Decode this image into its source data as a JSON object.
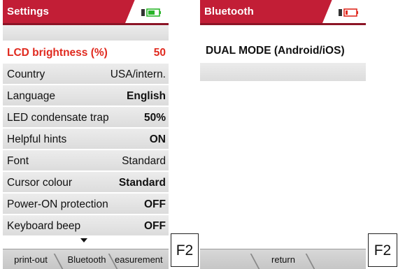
{
  "settings": {
    "title": "Settings",
    "rows": [
      {
        "label": "LCD brightness (%)",
        "value": "50"
      },
      {
        "label": "Country",
        "value": "USA/intern."
      },
      {
        "label": "Language",
        "value": "English"
      },
      {
        "label": "LED condensate trap",
        "value": "50%"
      },
      {
        "label": "Helpful hints",
        "value": "ON"
      },
      {
        "label": "Font",
        "value": "Standard"
      },
      {
        "label": "Cursor colour",
        "value": "Standard"
      },
      {
        "label": "Power-ON protection",
        "value": "OFF"
      },
      {
        "label": "Keyboard beep",
        "value": "OFF"
      }
    ],
    "softkeys": [
      "print-out",
      "Bluetooth",
      "easurement"
    ],
    "f2_label": "F2"
  },
  "bluetooth": {
    "title": "Bluetooth",
    "rows": [
      {
        "label": "DUAL MODE (Android/iOS)"
      },
      {
        "label": ""
      }
    ],
    "softkeys": [
      "",
      "return",
      ""
    ],
    "f2_label": "F2"
  },
  "colors": {
    "titlebar": "#c21e36",
    "selected_text": "#e02a1f",
    "battery_green": "#2bb52b",
    "battery_red": "#e02a1f"
  },
  "icons": {
    "battery_settings": "battery-icon",
    "battery_bluetooth": "battery-icon",
    "scroll": "scroll-down-icon"
  }
}
